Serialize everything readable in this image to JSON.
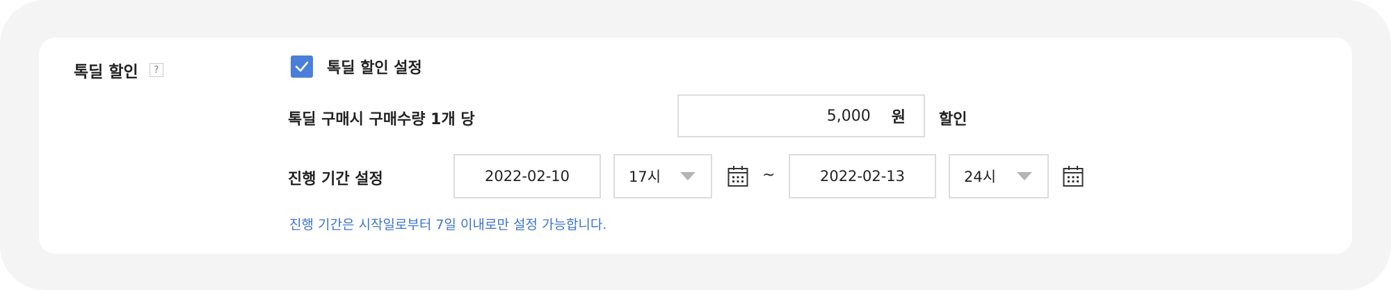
{
  "section": {
    "label": "톡딜 할인",
    "help": "?"
  },
  "discount_toggle": {
    "checked": true,
    "label": "톡딜 할인 설정"
  },
  "per_unit": {
    "label": "톡딜 구매시 구매수량 1개 당",
    "amount": "5,000",
    "unit": "원",
    "suffix": "할인"
  },
  "period": {
    "label": "진행 기간 설정",
    "start_date": "2022-02-10",
    "start_hour": "17시",
    "separator": "~",
    "end_date": "2022-02-13",
    "end_hour": "24시"
  },
  "notice": "진행 기간은 시작일로부터 7일 이내로만 설정 가능합니다.",
  "colors": {
    "accent": "#4a7fd9",
    "notice": "#3d73d1",
    "border": "#dcdcdc",
    "outer_bg": "#f4f4f4"
  },
  "icons": [
    "help-icon",
    "check-icon",
    "calendar-icon",
    "chevron-down-icon"
  ]
}
